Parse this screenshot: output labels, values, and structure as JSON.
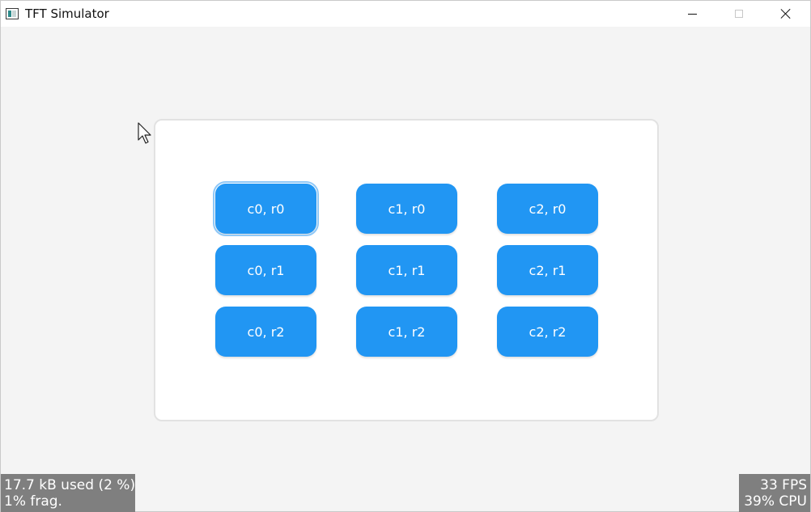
{
  "window": {
    "title": "TFT Simulator"
  },
  "grid": {
    "buttons": [
      {
        "label": "c0, r0",
        "focused": true
      },
      {
        "label": "c1, r0",
        "focused": false
      },
      {
        "label": "c2, r0",
        "focused": false
      },
      {
        "label": "c0, r1",
        "focused": false
      },
      {
        "label": "c1, r1",
        "focused": false
      },
      {
        "label": "c2, r1",
        "focused": false
      },
      {
        "label": "c0, r2",
        "focused": false
      },
      {
        "label": "c1, r2",
        "focused": false
      },
      {
        "label": "c2, r2",
        "focused": false
      }
    ]
  },
  "overlay": {
    "memory_line1": "17.7 kB used (2 %)",
    "memory_line2": "1% frag.",
    "fps": "33 FPS",
    "cpu": "39% CPU"
  },
  "colors": {
    "button": "#2196f3",
    "background": "#f4f4f4",
    "panel": "#ffffff",
    "overlay": "#7f7f7f"
  },
  "icons": {
    "app": "tft-simulator-app-icon",
    "minimize": "minimize-icon",
    "maximize": "maximize-icon",
    "close": "close-icon",
    "cursor": "mouse-pointer-icon"
  }
}
